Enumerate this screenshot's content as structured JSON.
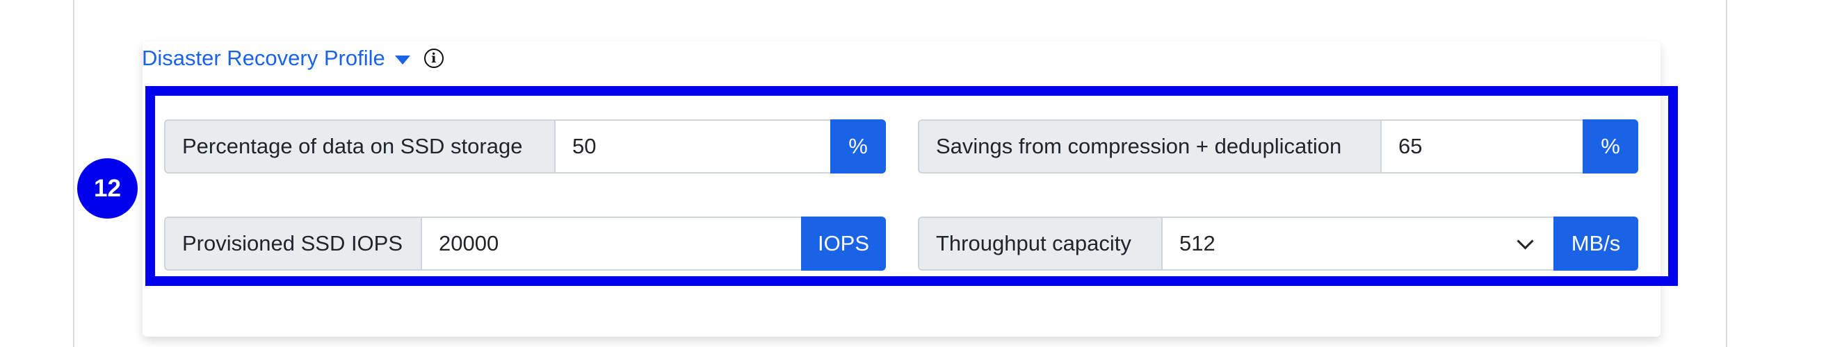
{
  "section": {
    "title": "Disaster Recovery Profile",
    "info_icon": "info-circle-icon",
    "toggle_icon": "caret-down-icon"
  },
  "step_badge": "12",
  "fields": {
    "ssd_percentage": {
      "label": "Percentage of data on SSD storage",
      "value": "50",
      "unit": "%"
    },
    "savings": {
      "label": "Savings from compression + deduplication",
      "value": "65",
      "unit": "%"
    },
    "provisioned_iops": {
      "label": "Provisioned SSD IOPS",
      "value": "20000",
      "unit": "IOPS"
    },
    "throughput": {
      "label": "Throughput capacity",
      "value": "512",
      "unit": "MB/s"
    }
  },
  "colors": {
    "accent": "#1a63e6",
    "highlight": "#0000ee",
    "label_bg": "#e9ecef"
  }
}
